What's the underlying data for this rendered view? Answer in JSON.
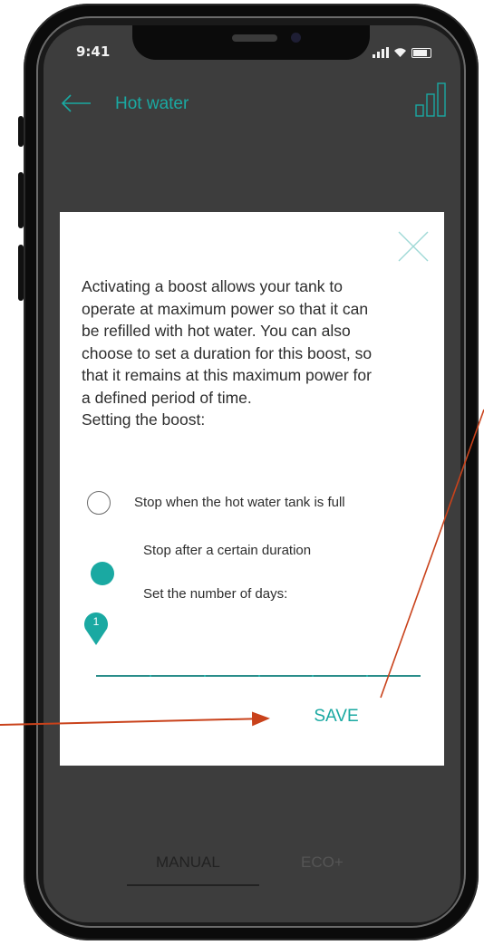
{
  "status_bar": {
    "time": "9:41"
  },
  "header": {
    "title": "Hot water"
  },
  "modal": {
    "description_lines": [
      "Activating a boost allows your tank to",
      "operate at maximum power so that it can",
      "be refilled with hot water. You can also",
      "choose to set a duration for this boost, so",
      "that it remains at this maximum power for",
      "a defined period of time.",
      "Setting the boost:"
    ],
    "option_full": {
      "label": "Stop when the hot water tank is full",
      "selected": false
    },
    "option_duration": {
      "label": "Stop after a certain duration",
      "selected": true
    },
    "days_label": "Set the number of days:",
    "slider": {
      "value": "1",
      "min": 1,
      "max": 7
    },
    "save_label": "SAVE"
  },
  "tabs": [
    {
      "label": "MANUAL",
      "active": true
    },
    {
      "label": "ECO+",
      "active": false
    }
  ],
  "colors": {
    "accent": "#1aa9a2",
    "annotation_arrow": "#c9421b",
    "overlay": "#3d3d3d"
  },
  "icons": {
    "back": "back-arrow-icon",
    "close": "close-icon",
    "stats": "bar-chart-icon"
  }
}
